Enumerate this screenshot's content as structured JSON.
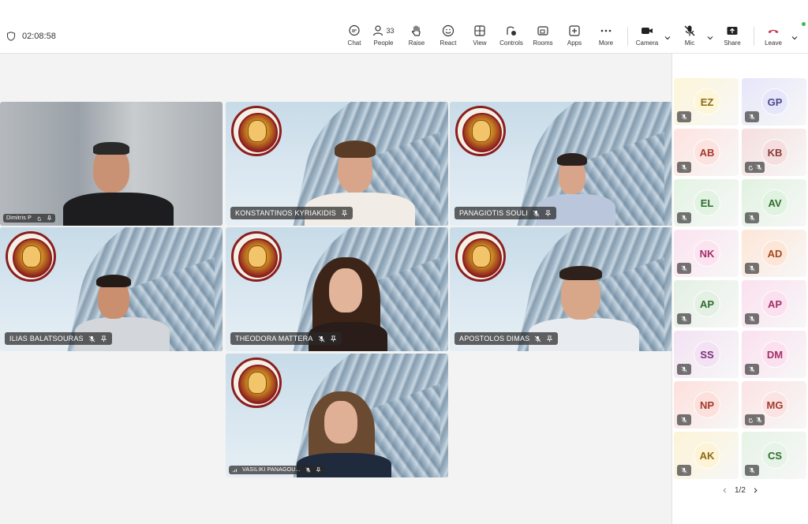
{
  "meeting": {
    "elapsed_time": "02:08:58"
  },
  "toolbar": {
    "chat": "Chat",
    "people": "People",
    "people_count": "33",
    "raise": "Raise",
    "react": "React",
    "view": "View",
    "controls": "Controls",
    "rooms": "Rooms",
    "apps": "Apps",
    "more": "More",
    "camera": "Camera",
    "mic": "Mic",
    "share": "Share",
    "leave": "Leave"
  },
  "video_tiles": [
    {
      "name": "Dimitris P"
    },
    {
      "name": "KONSTANTINOS KYRIAKIDIS"
    },
    {
      "name": "PANAGIOTIS SOULI"
    },
    {
      "name": "ILIAS BALATSOURAS"
    },
    {
      "name": "THEODORA MATTERA"
    },
    {
      "name": "APOSTOLOS DIMAS"
    },
    {
      "name": "VASILIKI PANAGOU..."
    }
  ],
  "participants_panel": {
    "avatars": [
      {
        "initials": "EZ",
        "bg": "#fdf6d8",
        "fg": "#8a6a10"
      },
      {
        "initials": "GP",
        "bg": "#e6e6fa",
        "fg": "#4a4a8a"
      },
      {
        "initials": "AB",
        "bg": "#fde3e0",
        "fg": "#a33a2e"
      },
      {
        "initials": "KB",
        "bg": "#f6dede",
        "fg": "#8a3a3a"
      },
      {
        "initials": "EL",
        "bg": "#e3f3e3",
        "fg": "#2e6e2e"
      },
      {
        "initials": "AV",
        "bg": "#e0f2e0",
        "fg": "#2e6e2e"
      },
      {
        "initials": "NK",
        "bg": "#fbe3ef",
        "fg": "#a3306a"
      },
      {
        "initials": "AD",
        "bg": "#fde6d8",
        "fg": "#a34a20"
      },
      {
        "initials": "AP",
        "bg": "#e3f0e3",
        "fg": "#2e6e2e"
      },
      {
        "initials": "AP",
        "bg": "#fbe0ef",
        "fg": "#a3306a"
      },
      {
        "initials": "SS",
        "bg": "#f3e2f3",
        "fg": "#7a307a"
      },
      {
        "initials": "DM",
        "bg": "#fbe0ef",
        "fg": "#a3306a"
      },
      {
        "initials": "NP",
        "bg": "#fde0dc",
        "fg": "#a33a2e"
      },
      {
        "initials": "MG",
        "bg": "#fbe3e3",
        "fg": "#a33a2e"
      },
      {
        "initials": "AK",
        "bg": "#fdf3d6",
        "fg": "#8a6a10"
      },
      {
        "initials": "CS",
        "bg": "#e6f3e6",
        "fg": "#2e6e2e"
      }
    ],
    "page_indicator": "1/2"
  },
  "colors": {
    "accent": "#c4314b",
    "topbar_bg": "#ffffff",
    "stage_bg": "#f3f3f3"
  }
}
